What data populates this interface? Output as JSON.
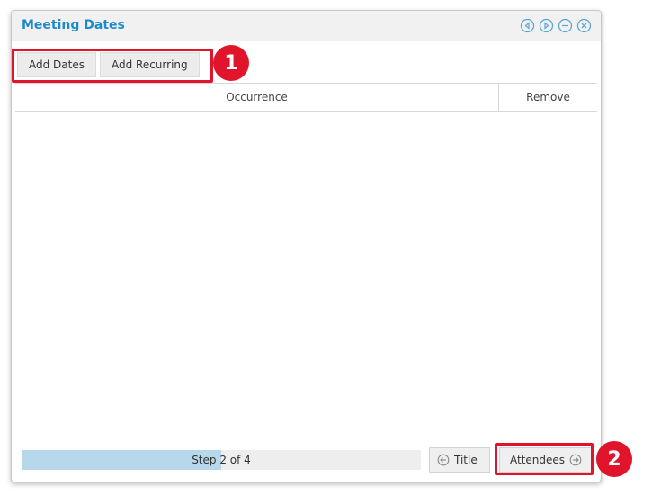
{
  "dialog": {
    "title": "Meeting Dates",
    "controls": [
      {
        "name": "previous-icon"
      },
      {
        "name": "next-icon"
      },
      {
        "name": "minimize-icon"
      },
      {
        "name": "close-icon"
      }
    ]
  },
  "toolbar": {
    "add_dates_label": "Add Dates",
    "add_recurring_label": "Add Recurring"
  },
  "table": {
    "columns": [
      "Occurrence",
      "Remove"
    ],
    "rows": []
  },
  "wizard": {
    "step_label": "Step 2 of 4",
    "progress_fraction": 0.5,
    "prev_label": "Title",
    "next_label": "Attendees"
  },
  "annotations": [
    {
      "number": "1"
    },
    {
      "number": "2"
    }
  ],
  "colors": {
    "title": "#1f8ac9",
    "highlight": "#e0142a",
    "progress_fill": "#b7d8ea"
  }
}
